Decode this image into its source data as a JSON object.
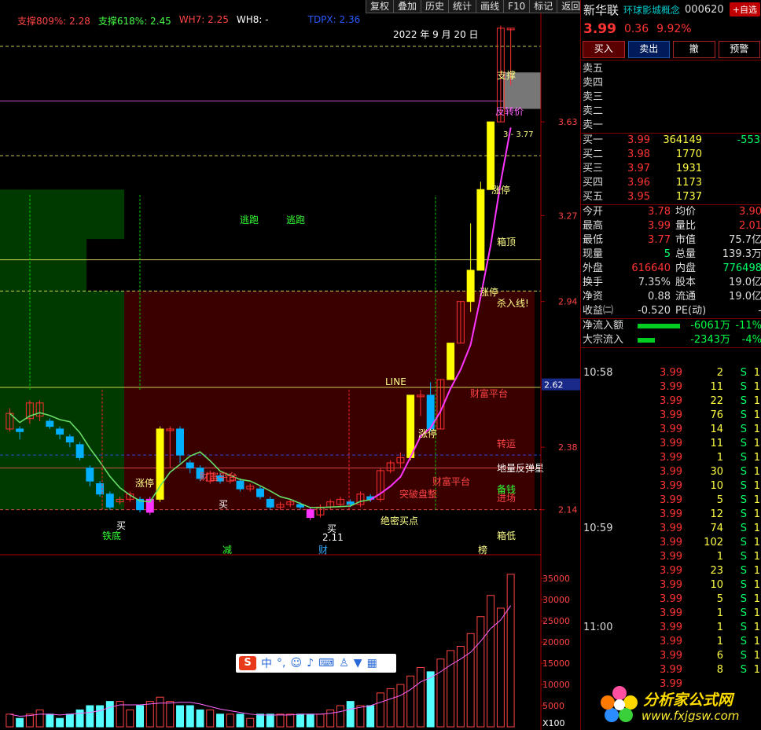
{
  "toolbar": [
    "复权",
    "叠加",
    "历史",
    "统计",
    "画线",
    "F10",
    "标记",
    "返回"
  ],
  "legend": [
    {
      "label": "支撑809%: 2.28",
      "color": "#ff4444"
    },
    {
      "label": "支撑618%: 2.45",
      "color": "#44ff44"
    },
    {
      "label": "WH7: 2.25",
      "color": "#ff4444"
    },
    {
      "label": "WH8: -",
      "color": "#ffffff"
    },
    {
      "label": "TDPX: 2.36",
      "color": "#2a5aff"
    }
  ],
  "chart_annotations": {
    "date_label": "2022 年 9 月 20 日",
    "support": "支撑",
    "reversal": "反转价",
    "escape": "逃跑",
    "box_top": "箱顶",
    "box_bottom": "箱低",
    "sell_line": "杀入线!",
    "limit_up": "涨停",
    "wealth_platform": "财富平台",
    "tie_di": "铁底",
    "turn_luck": "转运",
    "ground_rebound": "地量反弹星",
    "prep_money": "备钱",
    "enter": "进场",
    "secret_buy": "绝密买点",
    "breakout": "突破盘整",
    "line": "LINE",
    "buy": "买",
    "cai": "财",
    "jian": "减",
    "bang": "榜",
    "low_mark": "2.11",
    "price_small": "3 - 3.77"
  },
  "axis": {
    "price_ticks": [
      "3.63",
      "3.27",
      "2.94",
      "2.62",
      "2.38",
      "2.14"
    ],
    "volume_ticks": [
      "35000",
      "30000",
      "25000",
      "20000",
      "15000",
      "10000",
      "5000"
    ],
    "vol_unit": "X100",
    "current_price_tag": "2.62"
  },
  "chart_data": {
    "type": "candlestick",
    "ylim": [
      2.0,
      4.05
    ],
    "candles": [
      [
        2.45,
        2.51,
        2.44,
        2.53
      ],
      [
        2.45,
        2.44,
        2.41,
        2.46
      ],
      [
        2.49,
        2.55,
        2.47,
        2.56
      ],
      [
        2.5,
        2.55,
        2.48,
        2.56
      ],
      [
        2.48,
        2.46,
        2.45,
        2.49
      ],
      [
        2.45,
        2.43,
        2.41,
        2.46
      ],
      [
        2.42,
        2.4,
        2.38,
        2.43
      ],
      [
        2.39,
        2.34,
        2.33,
        2.4
      ],
      [
        2.3,
        2.25,
        2.23,
        2.31
      ],
      [
        2.24,
        2.2,
        2.19,
        2.25
      ],
      [
        2.2,
        2.15,
        2.14,
        2.21
      ],
      [
        2.17,
        2.18,
        2.16,
        2.19
      ],
      [
        2.18,
        2.2,
        2.17,
        2.21
      ],
      [
        2.18,
        2.14,
        2.13,
        2.19
      ],
      [
        2.13,
        2.18,
        2.12,
        2.19
      ],
      [
        2.18,
        2.45,
        2.17,
        2.46
      ],
      [
        2.45,
        2.45,
        2.3,
        2.46
      ],
      [
        2.45,
        2.35,
        2.32,
        2.46
      ],
      [
        2.32,
        2.3,
        2.28,
        2.33
      ],
      [
        2.3,
        2.26,
        2.25,
        2.31
      ],
      [
        2.25,
        2.28,
        2.24,
        2.29
      ],
      [
        2.27,
        2.25,
        2.24,
        2.28
      ],
      [
        2.25,
        2.27,
        2.24,
        2.28
      ],
      [
        2.25,
        2.22,
        2.21,
        2.26
      ],
      [
        2.22,
        2.23,
        2.21,
        2.24
      ],
      [
        2.22,
        2.19,
        2.18,
        2.23
      ],
      [
        2.18,
        2.15,
        2.14,
        2.19
      ],
      [
        2.15,
        2.16,
        2.14,
        2.17
      ],
      [
        2.16,
        2.17,
        2.15,
        2.18
      ],
      [
        2.16,
        2.15,
        2.14,
        2.17
      ],
      [
        2.14,
        2.11,
        2.1,
        2.15
      ],
      [
        2.12,
        2.15,
        2.11,
        2.16
      ],
      [
        2.15,
        2.17,
        2.14,
        2.18
      ],
      [
        2.16,
        2.18,
        2.15,
        2.19
      ],
      [
        2.17,
        2.16,
        2.15,
        2.18
      ],
      [
        2.16,
        2.2,
        2.15,
        2.21
      ],
      [
        2.19,
        2.18,
        2.17,
        2.2
      ],
      [
        2.18,
        2.29,
        2.17,
        2.3
      ],
      [
        2.29,
        2.32,
        2.28,
        2.33
      ],
      [
        2.32,
        2.34,
        2.3,
        2.36
      ],
      [
        2.34,
        2.58,
        2.33,
        2.58
      ],
      [
        2.58,
        2.58,
        2.5,
        2.6
      ],
      [
        2.58,
        2.45,
        2.44,
        2.63
      ],
      [
        2.45,
        2.64,
        2.45,
        2.64
      ],
      [
        2.64,
        2.78,
        2.64,
        2.78
      ],
      [
        2.78,
        2.94,
        2.78,
        2.94
      ],
      [
        2.94,
        3.06,
        2.9,
        3.24
      ],
      [
        3.06,
        3.37,
        3.06,
        3.4
      ],
      [
        3.37,
        3.63,
        3.37,
        3.63
      ],
      [
        3.63,
        3.99,
        3.63,
        4.0
      ],
      [
        3.99,
        3.99,
        3.77,
        3.99
      ]
    ],
    "volumes": [
      3,
      2,
      3,
      4,
      3,
      2,
      3,
      4,
      5,
      5,
      6,
      6,
      4,
      5,
      6,
      7,
      6,
      5,
      5,
      4,
      4,
      3,
      3,
      3,
      2,
      3,
      3,
      3,
      3,
      3,
      3,
      3,
      4,
      5,
      6,
      5,
      5,
      8,
      9,
      10,
      12,
      14,
      13,
      16,
      18,
      19,
      22,
      26,
      31,
      28,
      36
    ]
  },
  "stock": {
    "name": "新华联",
    "concept": "环球影城概念",
    "code": "000620",
    "add_fav": "+自选",
    "price": "3.99",
    "change": "0.36",
    "pct": "9.92%"
  },
  "trade_buttons": [
    "买入",
    "卖出",
    "撤",
    "预警"
  ],
  "sell_book": [
    "卖五",
    "卖四",
    "卖三",
    "卖二",
    "卖一"
  ],
  "buy_book": [
    {
      "label": "买一",
      "price": "3.99",
      "vol": "364149",
      "chg": "-553"
    },
    {
      "label": "买二",
      "price": "3.98",
      "vol": "1770",
      "chg": ""
    },
    {
      "label": "买三",
      "price": "3.97",
      "vol": "1931",
      "chg": ""
    },
    {
      "label": "买四",
      "price": "3.96",
      "vol": "1173",
      "chg": ""
    },
    {
      "label": "买五",
      "price": "3.95",
      "vol": "1737",
      "chg": ""
    }
  ],
  "stats": [
    {
      "l1": "今开",
      "v1": "3.78",
      "c1": "#ff3333",
      "l2": "均价",
      "v2": "3.90",
      "c2": "#ff3333"
    },
    {
      "l1": "最高",
      "v1": "3.99",
      "c1": "#ff3333",
      "l2": "量比",
      "v2": "2.01",
      "c2": "#ff3333"
    },
    {
      "l1": "最低",
      "v1": "3.77",
      "c1": "#ff3333",
      "l2": "市值",
      "v2": "75.7亿",
      "c2": "#ddd"
    },
    {
      "l1": "现量",
      "v1": "5",
      "c1": "#00ff66",
      "l2": "总量",
      "v2": "139.3万",
      "c2": "#ddd"
    },
    {
      "l1": "外盘",
      "v1": "616640",
      "c1": "#ff3333",
      "l2": "内盘",
      "v2": "776498",
      "c2": "#00ff66"
    },
    {
      "l1": "换手",
      "v1": "7.35%",
      "c1": "#ddd",
      "l2": "股本",
      "v2": "19.0亿",
      "c2": "#ddd"
    },
    {
      "l1": "净资",
      "v1": "0.88",
      "c1": "#ddd",
      "l2": "流通",
      "v2": "19.0亿",
      "c2": "#ddd"
    },
    {
      "l1": "收益㈡",
      "v1": "-0.520",
      "c1": "#ddd",
      "l2": "PE(动)",
      "v2": "-",
      "c2": "#ddd"
    }
  ],
  "flow": [
    {
      "label": "净流入额",
      "value": "-6061万",
      "pct": "-11%"
    },
    {
      "label": "大宗流入",
      "value": "-2343万",
      "pct": "-4%"
    }
  ],
  "ticks": [
    {
      "t": "10:58",
      "p": "3.99",
      "v": "2",
      "s": "S",
      "x": "1"
    },
    {
      "t": "",
      "p": "3.99",
      "v": "11",
      "s": "S",
      "x": "1"
    },
    {
      "t": "",
      "p": "3.99",
      "v": "22",
      "s": "S",
      "x": "1"
    },
    {
      "t": "",
      "p": "3.99",
      "v": "76",
      "s": "S",
      "x": "1"
    },
    {
      "t": "",
      "p": "3.99",
      "v": "14",
      "s": "S",
      "x": "1"
    },
    {
      "t": "",
      "p": "3.99",
      "v": "11",
      "s": "S",
      "x": "1"
    },
    {
      "t": "",
      "p": "3.99",
      "v": "1",
      "s": "S",
      "x": "1"
    },
    {
      "t": "",
      "p": "3.99",
      "v": "30",
      "s": "S",
      "x": "1"
    },
    {
      "t": "",
      "p": "3.99",
      "v": "10",
      "s": "S",
      "x": "1"
    },
    {
      "t": "",
      "p": "3.99",
      "v": "5",
      "s": "S",
      "x": "1"
    },
    {
      "t": "",
      "p": "3.99",
      "v": "12",
      "s": "S",
      "x": "1"
    },
    {
      "t": "10:59",
      "p": "3.99",
      "v": "74",
      "s": "S",
      "x": "1"
    },
    {
      "t": "",
      "p": "3.99",
      "v": "102",
      "s": "S",
      "x": "1"
    },
    {
      "t": "",
      "p": "3.99",
      "v": "1",
      "s": "S",
      "x": "1"
    },
    {
      "t": "",
      "p": "3.99",
      "v": "23",
      "s": "S",
      "x": "1"
    },
    {
      "t": "",
      "p": "3.99",
      "v": "10",
      "s": "S",
      "x": "1"
    },
    {
      "t": "",
      "p": "3.99",
      "v": "5",
      "s": "S",
      "x": "1"
    },
    {
      "t": "",
      "p": "3.99",
      "v": "1",
      "s": "S",
      "x": "1"
    },
    {
      "t": "11:00",
      "p": "3.99",
      "v": "1",
      "s": "S",
      "x": "1"
    },
    {
      "t": "",
      "p": "3.99",
      "v": "1",
      "s": "S",
      "x": "1"
    },
    {
      "t": "",
      "p": "3.99",
      "v": "6",
      "s": "S",
      "x": "1"
    },
    {
      "t": "",
      "p": "3.99",
      "v": "8",
      "s": "S",
      "x": "1"
    },
    {
      "t": "",
      "p": "3.99",
      "v": "",
      "s": "",
      "x": ""
    }
  ],
  "ime": {
    "label": "中"
  },
  "logo": {
    "title": "分析家公式网",
    "url": "www.fxjgsw.com"
  }
}
